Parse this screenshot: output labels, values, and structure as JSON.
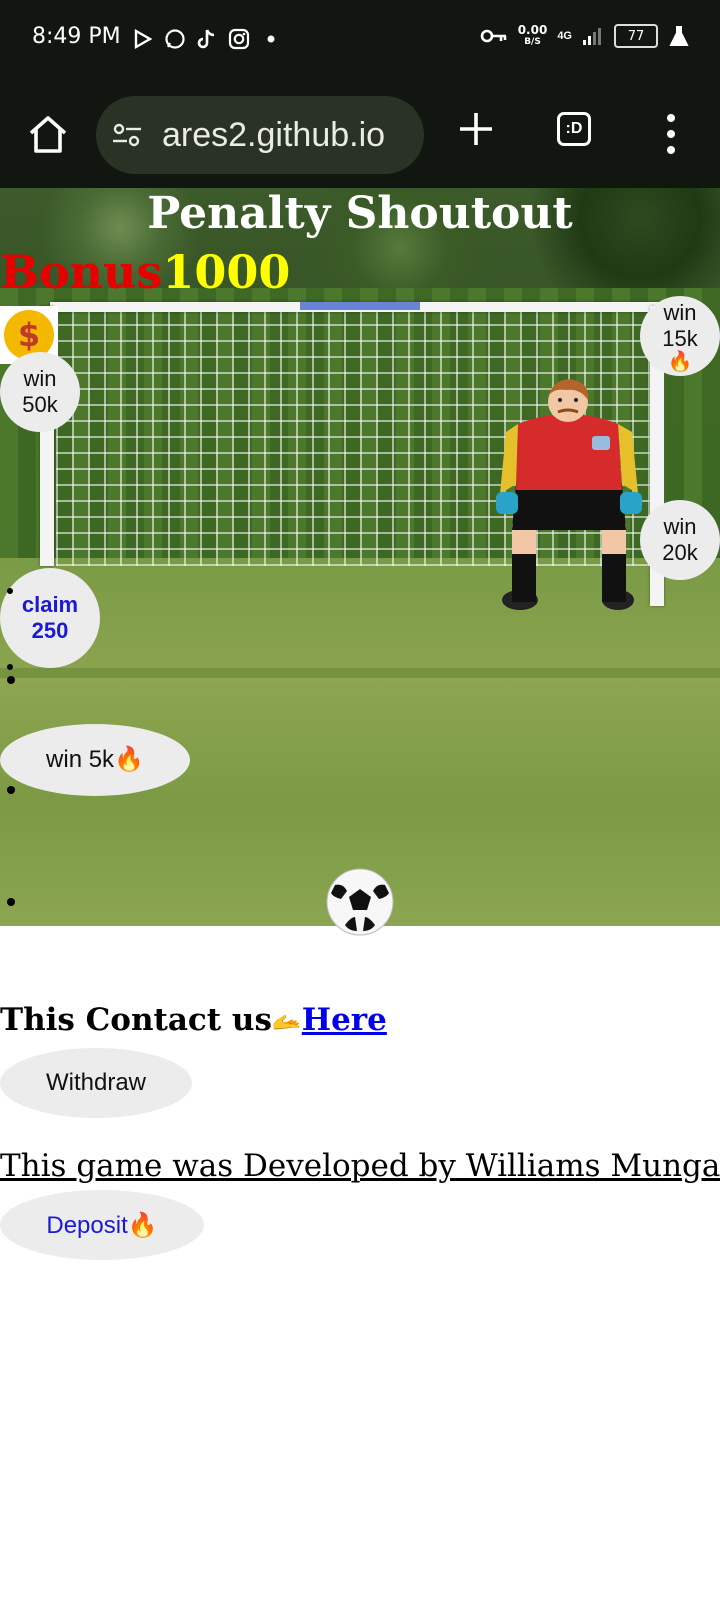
{
  "status_bar": {
    "time": "8:49 PM",
    "net_speed_value": "0.00",
    "net_speed_unit": "B/S",
    "network": "4G",
    "battery": "77"
  },
  "browser": {
    "url": "ares2.github.io",
    "tabs_label": ":D"
  },
  "game": {
    "title": "Penalty Shoutout",
    "bonus_label": "Bonus",
    "bonus_value": "1000",
    "coin_symbol": "$",
    "bubbles": {
      "win_50k": "win 50k",
      "win_15k": "win 15k",
      "win_15k_emoji": "🔥",
      "win_20k": "win 20k",
      "claim_250": "claim 250",
      "win_5k": "win 5k🔥"
    }
  },
  "footer": {
    "contact_prefix": "This Contact us",
    "contact_emoji": "🫴",
    "contact_link": "Here",
    "withdraw_label": "Withdraw",
    "developer_text": "This game was Developed by Williams Mungau",
    "deposit_label": "Deposit🔥"
  },
  "colors": {
    "bonus_label": "#e60000",
    "bonus_value": "#ffff00",
    "link": "#0000ee",
    "bubble_bg": "#ececec"
  }
}
